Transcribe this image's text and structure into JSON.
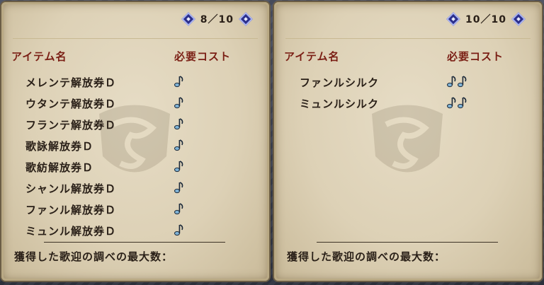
{
  "panels": [
    {
      "page": "8／10",
      "header_name": "アイテム名",
      "header_cost": "必要コスト",
      "items": [
        {
          "name": "メレンテ解放券Ｄ",
          "cost": 1
        },
        {
          "name": "ウタンテ解放券Ｄ",
          "cost": 1
        },
        {
          "name": "フランテ解放券Ｄ",
          "cost": 1
        },
        {
          "name": "歌詠解放券Ｄ",
          "cost": 1
        },
        {
          "name": "歌紡解放券Ｄ",
          "cost": 1
        },
        {
          "name": "シャンル解放券Ｄ",
          "cost": 1
        },
        {
          "name": "ファンル解放券Ｄ",
          "cost": 1
        },
        {
          "name": "ミュンル解放券Ｄ",
          "cost": 1
        }
      ],
      "footer": "獲得した歌迎の調べの最大数："
    },
    {
      "page": "10／10",
      "header_name": "アイテム名",
      "header_cost": "必要コスト",
      "items": [
        {
          "name": "ファンルシルク",
          "cost": 2
        },
        {
          "name": "ミュンルシルク",
          "cost": 2
        }
      ],
      "footer": "獲得した歌迎の調べの最大数："
    }
  ],
  "colors": {
    "header": "#7a1e14",
    "text": "#2a2018",
    "note": "#7fb3d6",
    "arrow": "#2b2f8c"
  },
  "icons": {
    "cost": "music-note-icon",
    "prev": "prev-page-icon",
    "next": "next-page-icon",
    "emblem": "guild-emblem-icon"
  }
}
